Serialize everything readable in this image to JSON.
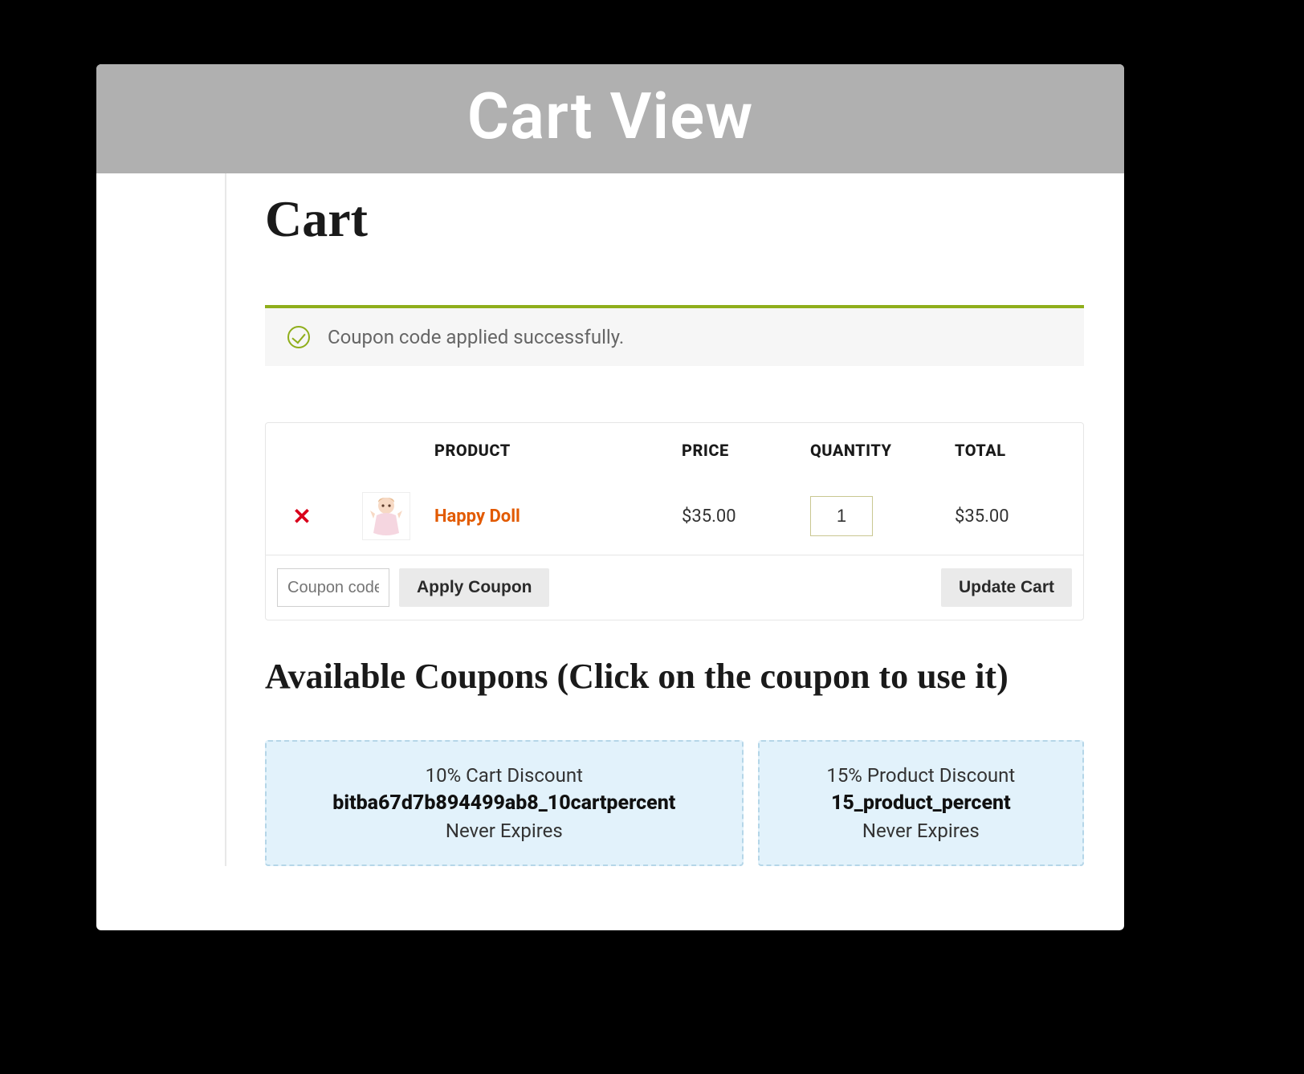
{
  "banner": {
    "title": "Cart View"
  },
  "page": {
    "title": "Cart"
  },
  "notice": {
    "message": "Coupon code applied successfully."
  },
  "table": {
    "headers": {
      "product": "PRODUCT",
      "price": "PRICE",
      "quantity": "QUANTITY",
      "total": "TOTAL"
    },
    "row": {
      "name": "Happy Doll",
      "price": "$35.00",
      "quantity": "1",
      "total": "$35.00"
    }
  },
  "actions": {
    "coupon_placeholder": "Coupon code",
    "apply_label": "Apply Coupon",
    "update_label": "Update Cart"
  },
  "coupons_section": {
    "title": "Available Coupons (Click on the coupon to use it)"
  },
  "coupons": [
    {
      "desc": "10% Cart Discount",
      "code": "bitba67d7b894499ab8_10cartpercent",
      "expires": "Never Expires"
    },
    {
      "desc": "15% Product Discount",
      "code": "15_product_percent",
      "expires": "Never Expires"
    }
  ]
}
